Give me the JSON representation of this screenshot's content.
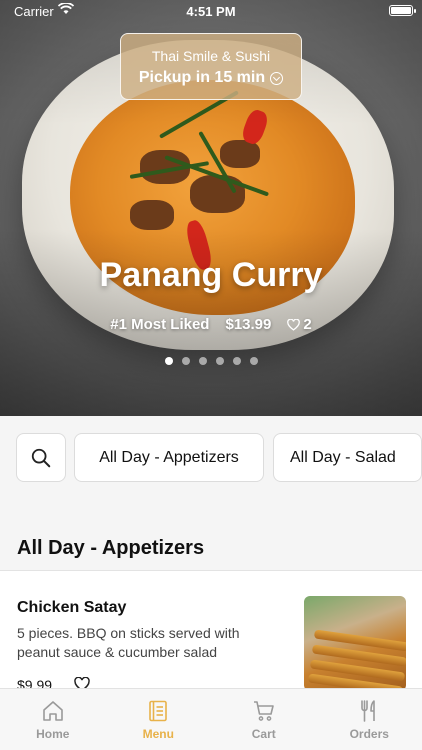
{
  "status_bar": {
    "carrier": "Carrier",
    "time": "4:51 PM"
  },
  "pickup": {
    "restaurant": "Thai Smile & Sushi",
    "time_label": "Pickup in 15 min"
  },
  "hero": {
    "title": "Panang Curry",
    "badge": "#1 Most Liked",
    "price": "$13.99",
    "likes": "2",
    "carousel": {
      "count": 6,
      "active": 0
    }
  },
  "categories": [
    "All Day - Appetizers",
    "All Day - Salad"
  ],
  "section": {
    "title": "All Day - Appetizers"
  },
  "item": {
    "name": "Chicken Satay",
    "description": "5 pieces. BBQ on sticks served with peanut sauce & cucumber salad",
    "price": "$9.99"
  },
  "tabs": [
    {
      "label": "Home",
      "icon": "home-icon"
    },
    {
      "label": "Menu",
      "icon": "menu-icon",
      "active": true
    },
    {
      "label": "Cart",
      "icon": "cart-icon"
    },
    {
      "label": "Orders",
      "icon": "fork-knife-icon"
    }
  ],
  "colors": {
    "accent": "#e8b24a",
    "pickup_bg": "#cdaf82"
  }
}
